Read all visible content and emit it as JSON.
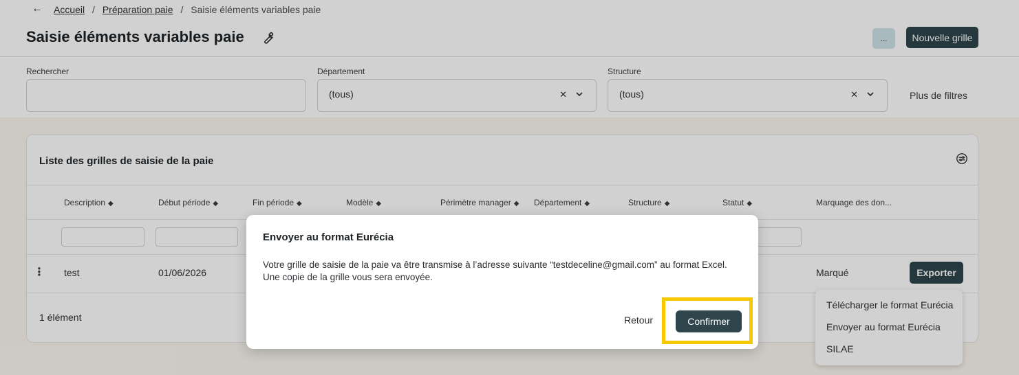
{
  "breadcrumb": {
    "back_icon": "arrow-left-icon",
    "items": [
      "Accueil",
      "Préparation paie",
      "Saisie éléments variables paie"
    ],
    "separator": "/"
  },
  "header": {
    "title": "Saisie éléments variables paie",
    "title_icon": "wrench-icon",
    "more_label": "...",
    "new_grid_label": "Nouvelle grille"
  },
  "filters": {
    "search": {
      "label": "Rechercher",
      "value": ""
    },
    "department": {
      "label": "Département",
      "value": "(tous)"
    },
    "structure": {
      "label": "Structure",
      "value": "(tous)"
    },
    "more_filters_label": "Plus de filtres"
  },
  "table": {
    "title": "Liste des grilles de saisie de la paie",
    "columns": [
      "Description",
      "Début période",
      "Fin période",
      "Modèle",
      "Périmètre manager",
      "Département",
      "Structure",
      "Statut",
      "Marquage des don..."
    ],
    "rows": [
      {
        "description": "test",
        "debut": "01/06/2026",
        "marquage": "Marqué",
        "action_label": "Exporter"
      }
    ],
    "count_label": "1 élément"
  },
  "export_menu": {
    "items": [
      "Télécharger le format Eurécia",
      "Envoyer au format Eurécia",
      "SILAE"
    ]
  },
  "modal": {
    "title": "Envoyer au format Eurécia",
    "text_line1": "Votre grille de saisie de la paie va être transmise à l’adresse suivante “testdeceline@gmail.com” au format Excel.",
    "text_line2": "Une copie de la grille vous sera envoyée.",
    "back_label": "Retour",
    "confirm_label": "Confirmer"
  },
  "colors": {
    "primary": "#2e454b",
    "highlight": "#f5c800",
    "background": "#fbf7ef"
  }
}
